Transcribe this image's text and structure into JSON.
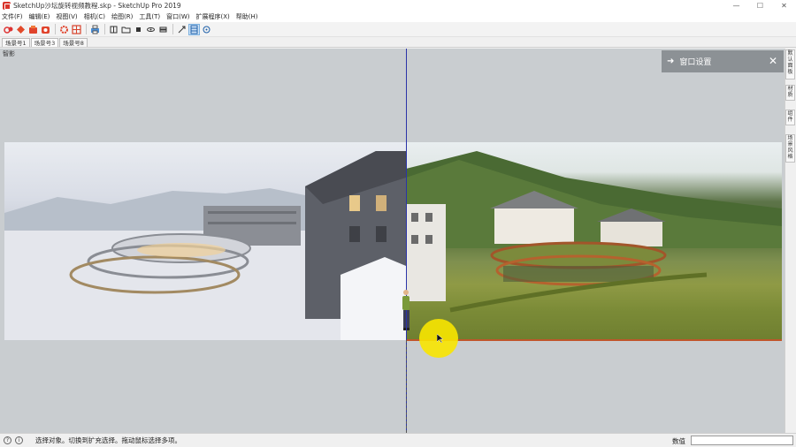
{
  "window": {
    "title": "SketchUp沙坛旋转视频教程.skp - SketchUp Pro 2019",
    "minimize": "—",
    "maximize": "☐",
    "close": "✕"
  },
  "menu": [
    "文件(F)",
    "编辑(E)",
    "视图(V)",
    "相机(C)",
    "绘图(R)",
    "工具(T)",
    "窗口(W)",
    "扩展程序(X)",
    "帮助(H)"
  ],
  "scene_tabs": [
    "场景号1",
    "场景号3",
    "场景号8"
  ],
  "viewport": {
    "label": "智影"
  },
  "panel": {
    "title": "窗口设置",
    "icon": "arrow-right-icon"
  },
  "right_tabs": [
    "默认面板",
    "材质",
    "组件",
    "场景风格"
  ],
  "status": {
    "message": "选择对象。切换到扩充选择。拖动鼠标选择多项。",
    "measure_label": "数值",
    "measure_value": ""
  },
  "colors": {
    "axis_blue": "#2b34a8",
    "highlight_yellow": "#f8e600",
    "panel_bg": "#8c9195"
  }
}
